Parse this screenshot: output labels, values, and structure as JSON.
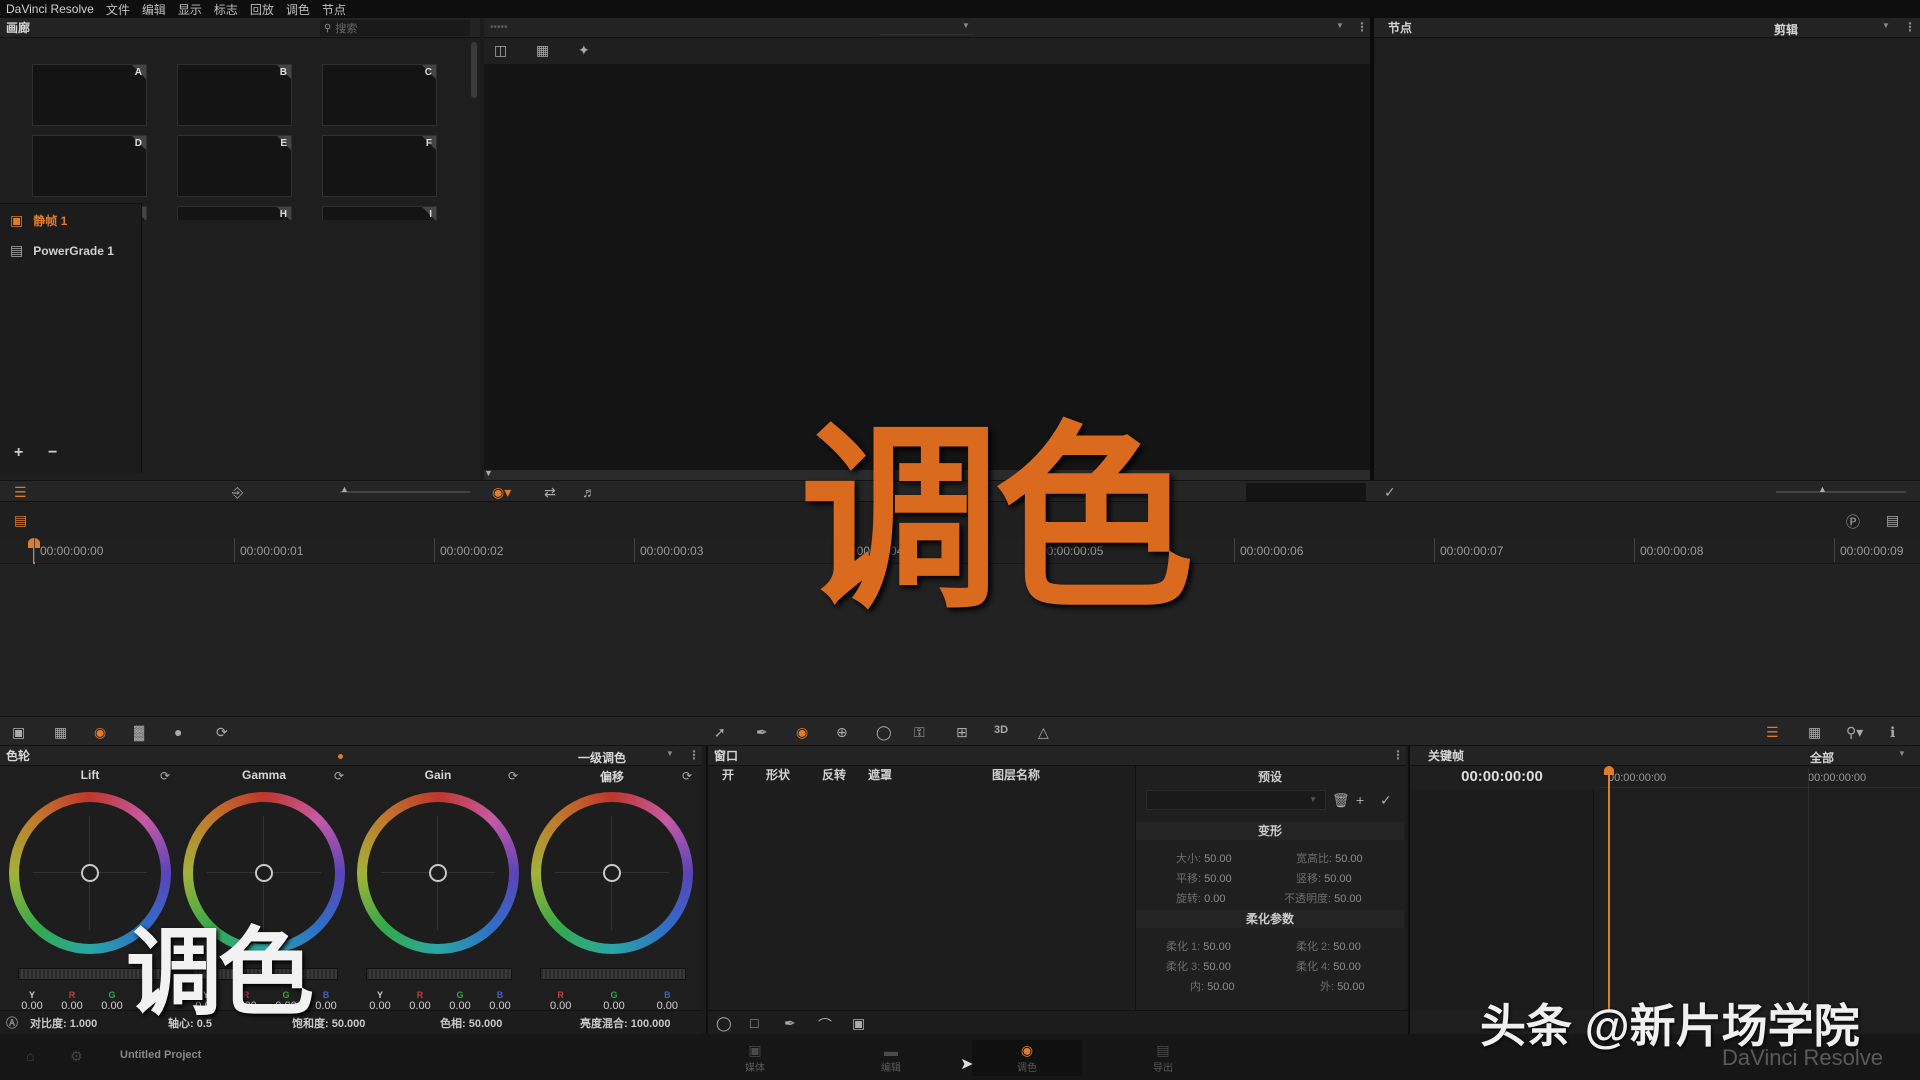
{
  "menu": {
    "app_title": "DaVinci Resolve",
    "items": [
      "文件",
      "编辑",
      "显示",
      "标志",
      "回放",
      "调色",
      "节点"
    ]
  },
  "gallery": {
    "title": "画廊",
    "search_placeholder": "搜索",
    "stills": [
      "A",
      "B",
      "C",
      "D",
      "E",
      "F",
      "G",
      "H",
      "I"
    ],
    "albums": [
      {
        "label": "静帧 1",
        "active": true
      },
      {
        "label": "PowerGrade 1",
        "active": false
      }
    ],
    "add_label": "+",
    "remove_label": "−"
  },
  "nodes_panel": {
    "title": "节点",
    "mode": "剪辑"
  },
  "timeline": {
    "timecodes": [
      "00:00:00:00",
      "00:00:00:01",
      "00:00:00:02",
      "00:00:00:03",
      "00:00:00:04",
      "00:00:00:05",
      "00:00:00:06",
      "00:00:00:07",
      "00:00:00:08",
      "00:00:00:09"
    ]
  },
  "color_wheels": {
    "title": "色轮",
    "mode": "一级调色",
    "wheels": [
      {
        "name": "Lift",
        "values": [
          {
            "ch": "Y",
            "color": "#cfcfcf",
            "v": "0.00"
          },
          {
            "ch": "R",
            "color": "#c23a3a",
            "v": "0.00"
          },
          {
            "ch": "G",
            "color": "#3aa14a",
            "v": "0.00"
          },
          {
            "ch": "B",
            "color": "#3a64c2",
            "v": "0.00"
          }
        ]
      },
      {
        "name": "Gamma",
        "values": [
          {
            "ch": "Y",
            "color": "#cfcfcf",
            "v": "0.00"
          },
          {
            "ch": "R",
            "color": "#c23a3a",
            "v": "0.00"
          },
          {
            "ch": "G",
            "color": "#3aa14a",
            "v": "0.00"
          },
          {
            "ch": "B",
            "color": "#3a64c2",
            "v": "0.00"
          }
        ]
      },
      {
        "name": "Gain",
        "values": [
          {
            "ch": "Y",
            "color": "#cfcfcf",
            "v": "0.00"
          },
          {
            "ch": "R",
            "color": "#c23a3a",
            "v": "0.00"
          },
          {
            "ch": "G",
            "color": "#3aa14a",
            "v": "0.00"
          },
          {
            "ch": "B",
            "color": "#3a64c2",
            "v": "0.00"
          }
        ]
      },
      {
        "name": "偏移",
        "values": [
          {
            "ch": "R",
            "color": "#c23a3a",
            "v": "0.00"
          },
          {
            "ch": "G",
            "color": "#3aa14a",
            "v": "0.00"
          },
          {
            "ch": "B",
            "color": "#3a64c2",
            "v": "0.00"
          }
        ]
      }
    ],
    "footer": {
      "contrast": "对比度: 1.000",
      "pivot": "轴心: 0.5",
      "saturation": "饱和度: 50.000",
      "hue": "色相: 50.000",
      "lum_mix": "亮度混合: 100.000"
    }
  },
  "window_panel": {
    "title": "窗口",
    "columns": [
      "开",
      "形状",
      "反转",
      "遮罩",
      "图层名称"
    ],
    "presets_title": "预设",
    "transform_title": "变形",
    "transform": [
      {
        "k": "大小:",
        "v": "50.00"
      },
      {
        "k": "宽高比:",
        "v": "50.00"
      },
      {
        "k": "平移:",
        "v": "50.00"
      },
      {
        "k": "竖移:",
        "v": "50.00"
      },
      {
        "k": "旋转:",
        "v": "0.00"
      },
      {
        "k": "不透明度:",
        "v": "50.00"
      }
    ],
    "soften_title": "柔化参数",
    "soften": [
      {
        "k": "柔化 1:",
        "v": "50.00"
      },
      {
        "k": "柔化 2:",
        "v": "50.00"
      },
      {
        "k": "柔化 3:",
        "v": "50.00"
      },
      {
        "k": "柔化 4:",
        "v": "50.00"
      },
      {
        "k": "内:",
        "v": "50.00"
      },
      {
        "k": "外:",
        "v": "50.00"
      }
    ]
  },
  "keyframes": {
    "title": "关键帧",
    "filter": "全部",
    "current_tc": "00:00:00:00",
    "ruler_tc1": "00:00:00:00",
    "ruler_tc2": "00:00:00:00"
  },
  "status": {
    "project": "Untitled Project"
  },
  "pages": [
    "媒体",
    "编辑",
    "调色",
    "导出"
  ],
  "overlay": {
    "big_title": "调色",
    "small_title": "调色",
    "watermark": "头条 @新片场学院",
    "watermark_sub": "DaVinci Resolve"
  },
  "colors": {
    "accent": "#e07b2a",
    "background": "#1b1b1b"
  }
}
